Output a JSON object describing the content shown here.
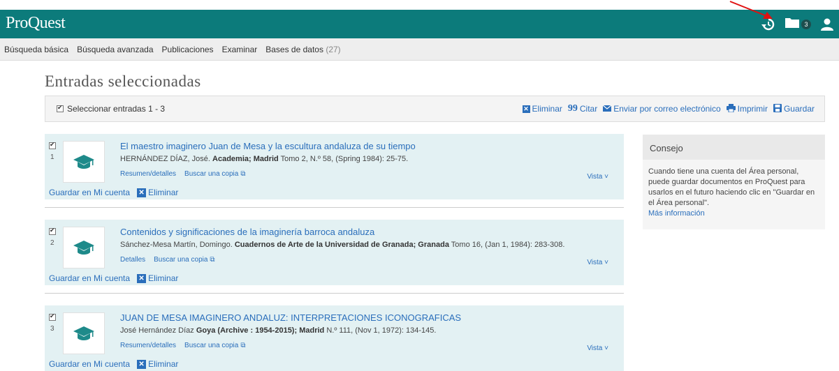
{
  "header": {
    "logo": "ProQuest",
    "folder_count": "3",
    "brand_color": "#0c7b7b",
    "icons": [
      "recent-searches-icon",
      "folder-icon",
      "user-icon"
    ]
  },
  "nav": {
    "items": [
      "Búsqueda básica",
      "Búsqueda avanzada",
      "Publicaciones",
      "Examinar",
      "Bases de datos"
    ],
    "db_count": "(27)"
  },
  "page": {
    "title": "Entradas seleccionadas"
  },
  "toolbar": {
    "select_label": "Seleccionar entradas 1 - 3",
    "actions": {
      "eliminar": "Eliminar",
      "citar": "Citar",
      "email": "Enviar por correo electrónico",
      "imprimir": "Imprimir",
      "guardar": "Guardar"
    }
  },
  "results": [
    {
      "num": "1",
      "title": "El maestro imaginero Juan de Mesa y la escultura andaluza de su tiempo",
      "author": "HERNÁNDEZ DÍAZ, José.",
      "source": "Academia; Madrid",
      "details": "Tomo 2, N.º 58,  (Spring 1984): 25-75.",
      "link1": "Resumen/detalles",
      "link2": "Buscar una copia",
      "vista": "Vista",
      "save": "Guardar en Mi cuenta",
      "remove": "Eliminar"
    },
    {
      "num": "2",
      "title": "Contenidos y significaciones de la imaginería barroca andaluza",
      "author": "Sánchez-Mesa Martín, Domingo.",
      "source": "Cuadernos de Arte de la Universidad de Granada; Granada",
      "details": "Tomo 16,  (Jan 1, 1984): 283-308.",
      "link1": "Detalles",
      "link2": "Buscar una copia",
      "vista": "Vista",
      "save": "Guardar en Mi cuenta",
      "remove": "Eliminar"
    },
    {
      "num": "3",
      "title": "JUAN DE MESA IMAGINERO ANDALUZ: INTERPRETACIONES ICONOGRAFICAS",
      "author": "José Hernández Díaz",
      "source": "Goya (Archive : 1954-2015); Madrid",
      "details": "N.º 111,  (Nov 1, 1972): 134-145.",
      "link1": "Resumen/detalles",
      "link2": "Buscar una copia",
      "vista": "Vista",
      "save": "Guardar en Mi cuenta",
      "remove": "Eliminar"
    }
  ],
  "tip": {
    "title": "Consejo",
    "body": "Cuando tiene una cuenta del Área personal, puede guardar documentos en ProQuest para usarlos en el futuro haciendo clic en \"Guardar en el Área personal\".",
    "more": "Más información"
  }
}
